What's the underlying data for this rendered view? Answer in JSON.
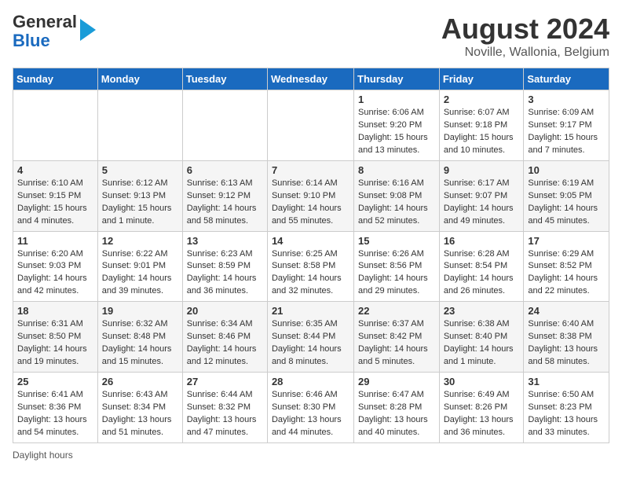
{
  "logo": {
    "line1": "General",
    "line2": "Blue"
  },
  "title": "August 2024",
  "location": "Noville, Wallonia, Belgium",
  "days_of_week": [
    "Sunday",
    "Monday",
    "Tuesday",
    "Wednesday",
    "Thursday",
    "Friday",
    "Saturday"
  ],
  "footer_text": "Daylight hours",
  "weeks": [
    [
      {
        "day": "",
        "info": ""
      },
      {
        "day": "",
        "info": ""
      },
      {
        "day": "",
        "info": ""
      },
      {
        "day": "",
        "info": ""
      },
      {
        "day": "1",
        "info": "Sunrise: 6:06 AM\nSunset: 9:20 PM\nDaylight: 15 hours and 13 minutes."
      },
      {
        "day": "2",
        "info": "Sunrise: 6:07 AM\nSunset: 9:18 PM\nDaylight: 15 hours and 10 minutes."
      },
      {
        "day": "3",
        "info": "Sunrise: 6:09 AM\nSunset: 9:17 PM\nDaylight: 15 hours and 7 minutes."
      }
    ],
    [
      {
        "day": "4",
        "info": "Sunrise: 6:10 AM\nSunset: 9:15 PM\nDaylight: 15 hours and 4 minutes."
      },
      {
        "day": "5",
        "info": "Sunrise: 6:12 AM\nSunset: 9:13 PM\nDaylight: 15 hours and 1 minute."
      },
      {
        "day": "6",
        "info": "Sunrise: 6:13 AM\nSunset: 9:12 PM\nDaylight: 14 hours and 58 minutes."
      },
      {
        "day": "7",
        "info": "Sunrise: 6:14 AM\nSunset: 9:10 PM\nDaylight: 14 hours and 55 minutes."
      },
      {
        "day": "8",
        "info": "Sunrise: 6:16 AM\nSunset: 9:08 PM\nDaylight: 14 hours and 52 minutes."
      },
      {
        "day": "9",
        "info": "Sunrise: 6:17 AM\nSunset: 9:07 PM\nDaylight: 14 hours and 49 minutes."
      },
      {
        "day": "10",
        "info": "Sunrise: 6:19 AM\nSunset: 9:05 PM\nDaylight: 14 hours and 45 minutes."
      }
    ],
    [
      {
        "day": "11",
        "info": "Sunrise: 6:20 AM\nSunset: 9:03 PM\nDaylight: 14 hours and 42 minutes."
      },
      {
        "day": "12",
        "info": "Sunrise: 6:22 AM\nSunset: 9:01 PM\nDaylight: 14 hours and 39 minutes."
      },
      {
        "day": "13",
        "info": "Sunrise: 6:23 AM\nSunset: 8:59 PM\nDaylight: 14 hours and 36 minutes."
      },
      {
        "day": "14",
        "info": "Sunrise: 6:25 AM\nSunset: 8:58 PM\nDaylight: 14 hours and 32 minutes."
      },
      {
        "day": "15",
        "info": "Sunrise: 6:26 AM\nSunset: 8:56 PM\nDaylight: 14 hours and 29 minutes."
      },
      {
        "day": "16",
        "info": "Sunrise: 6:28 AM\nSunset: 8:54 PM\nDaylight: 14 hours and 26 minutes."
      },
      {
        "day": "17",
        "info": "Sunrise: 6:29 AM\nSunset: 8:52 PM\nDaylight: 14 hours and 22 minutes."
      }
    ],
    [
      {
        "day": "18",
        "info": "Sunrise: 6:31 AM\nSunset: 8:50 PM\nDaylight: 14 hours and 19 minutes."
      },
      {
        "day": "19",
        "info": "Sunrise: 6:32 AM\nSunset: 8:48 PM\nDaylight: 14 hours and 15 minutes."
      },
      {
        "day": "20",
        "info": "Sunrise: 6:34 AM\nSunset: 8:46 PM\nDaylight: 14 hours and 12 minutes."
      },
      {
        "day": "21",
        "info": "Sunrise: 6:35 AM\nSunset: 8:44 PM\nDaylight: 14 hours and 8 minutes."
      },
      {
        "day": "22",
        "info": "Sunrise: 6:37 AM\nSunset: 8:42 PM\nDaylight: 14 hours and 5 minutes."
      },
      {
        "day": "23",
        "info": "Sunrise: 6:38 AM\nSunset: 8:40 PM\nDaylight: 14 hours and 1 minute."
      },
      {
        "day": "24",
        "info": "Sunrise: 6:40 AM\nSunset: 8:38 PM\nDaylight: 13 hours and 58 minutes."
      }
    ],
    [
      {
        "day": "25",
        "info": "Sunrise: 6:41 AM\nSunset: 8:36 PM\nDaylight: 13 hours and 54 minutes."
      },
      {
        "day": "26",
        "info": "Sunrise: 6:43 AM\nSunset: 8:34 PM\nDaylight: 13 hours and 51 minutes."
      },
      {
        "day": "27",
        "info": "Sunrise: 6:44 AM\nSunset: 8:32 PM\nDaylight: 13 hours and 47 minutes."
      },
      {
        "day": "28",
        "info": "Sunrise: 6:46 AM\nSunset: 8:30 PM\nDaylight: 13 hours and 44 minutes."
      },
      {
        "day": "29",
        "info": "Sunrise: 6:47 AM\nSunset: 8:28 PM\nDaylight: 13 hours and 40 minutes."
      },
      {
        "day": "30",
        "info": "Sunrise: 6:49 AM\nSunset: 8:26 PM\nDaylight: 13 hours and 36 minutes."
      },
      {
        "day": "31",
        "info": "Sunrise: 6:50 AM\nSunset: 8:23 PM\nDaylight: 13 hours and 33 minutes."
      }
    ]
  ]
}
